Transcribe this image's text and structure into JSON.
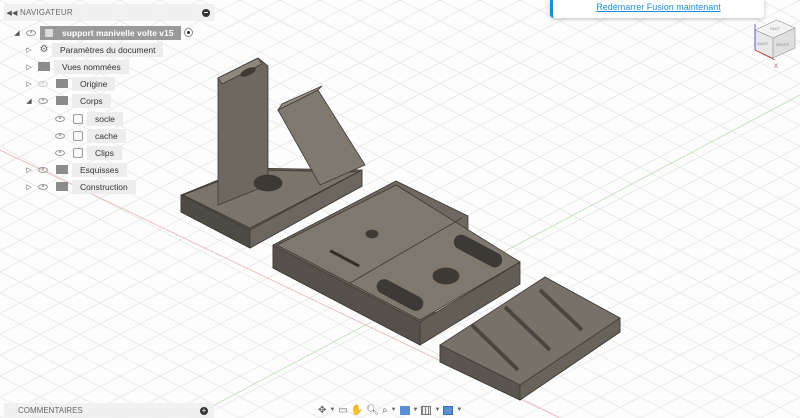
{
  "navigator": {
    "title": "NAVIGATEUR",
    "root": "support manivelle volte v15",
    "items": [
      {
        "label": "Paramètres du document",
        "icon": "gear-icon"
      },
      {
        "label": "Vues nommées",
        "icon": "folder-icon"
      },
      {
        "label": "Origine",
        "icon": "folder-icon"
      },
      {
        "label": "Corps",
        "icon": "folder-icon"
      },
      {
        "label": "socle",
        "icon": "body-icon"
      },
      {
        "label": "cache",
        "icon": "body-icon"
      },
      {
        "label": "Clips",
        "icon": "body-icon"
      },
      {
        "label": "Esquisses",
        "icon": "folder-icon"
      },
      {
        "label": "Construction",
        "icon": "folder-icon"
      }
    ]
  },
  "notification": {
    "link": "Redémarrer Fusion maintenant"
  },
  "viewcube": {
    "top": "HAUT",
    "front": "AVANT",
    "right": "DROITE",
    "axis_x": "X"
  },
  "comments": {
    "title": "COMMENTAIRES"
  },
  "colors": {
    "accent": "#1f8dd6",
    "model": "#6e6860"
  }
}
